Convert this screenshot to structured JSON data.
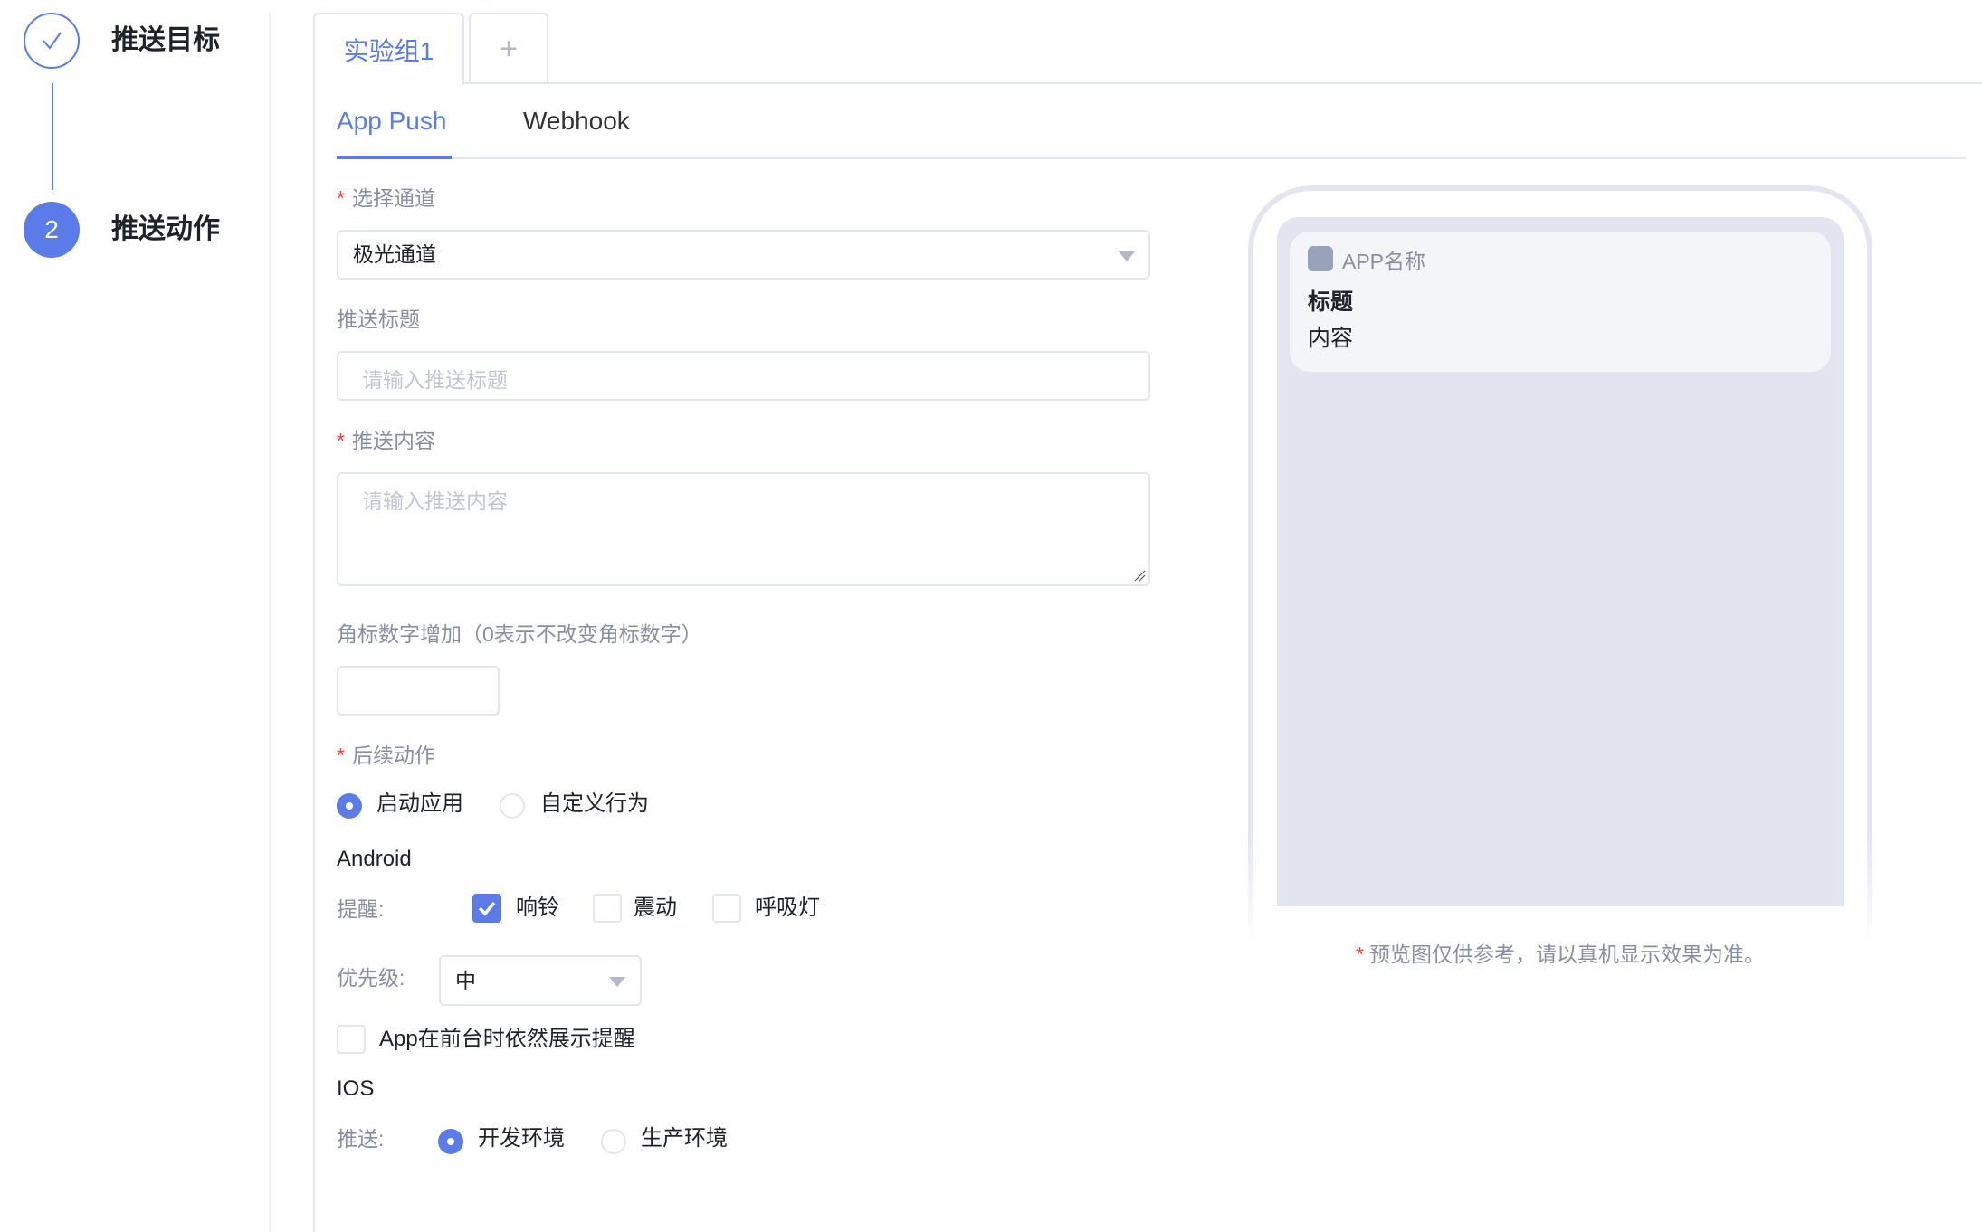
{
  "steps": [
    {
      "label": "推送目标",
      "state": "done",
      "icon": "check-icon"
    },
    {
      "label": "推送动作",
      "number": "2",
      "state": "active"
    }
  ],
  "group_tabs": [
    {
      "label": "实验组1",
      "active": true
    }
  ],
  "add_tab_label": "+",
  "channel_tabs": [
    {
      "label": "App Push",
      "active": true
    },
    {
      "label": "Webhook"
    }
  ],
  "form": {
    "channel": {
      "label": "选择通道",
      "required": true,
      "value": "极光通道"
    },
    "title": {
      "label": "推送标题",
      "placeholder": "请输入推送标题",
      "value": ""
    },
    "content": {
      "label": "推送内容",
      "required": true,
      "placeholder": "请输入推送内容",
      "value": ""
    },
    "badge": {
      "label": "角标数字增加（0表示不改变角标数字）",
      "value": ""
    },
    "action": {
      "label": "后续动作",
      "required": true,
      "options": [
        {
          "label": "启动应用",
          "selected": true
        },
        {
          "label": "自定义行为",
          "selected": false
        }
      ]
    },
    "android": {
      "heading": "Android",
      "remind_label": "提醒:",
      "reminders": [
        {
          "label": "响铃",
          "checked": true
        },
        {
          "label": "震动",
          "checked": false
        },
        {
          "label": "呼吸灯",
          "checked": false
        }
      ],
      "priority_label": "优先级:",
      "priority_value": "中",
      "foreground_label": "App在前台时依然展示提醒",
      "foreground_checked": false
    },
    "ios": {
      "heading": "IOS",
      "push_label": "推送:",
      "options": [
        {
          "label": "开发环境",
          "selected": true
        },
        {
          "label": "生产环境",
          "selected": false
        }
      ]
    }
  },
  "preview": {
    "app_name": "APP名称",
    "title": "标题",
    "content": "内容",
    "note": "预览图仅供参考，请以真机显示效果为准。",
    "required_mark": "*"
  },
  "required_mark": "*",
  "colors": {
    "accent": "#5b7be8",
    "required": "#f04134"
  }
}
